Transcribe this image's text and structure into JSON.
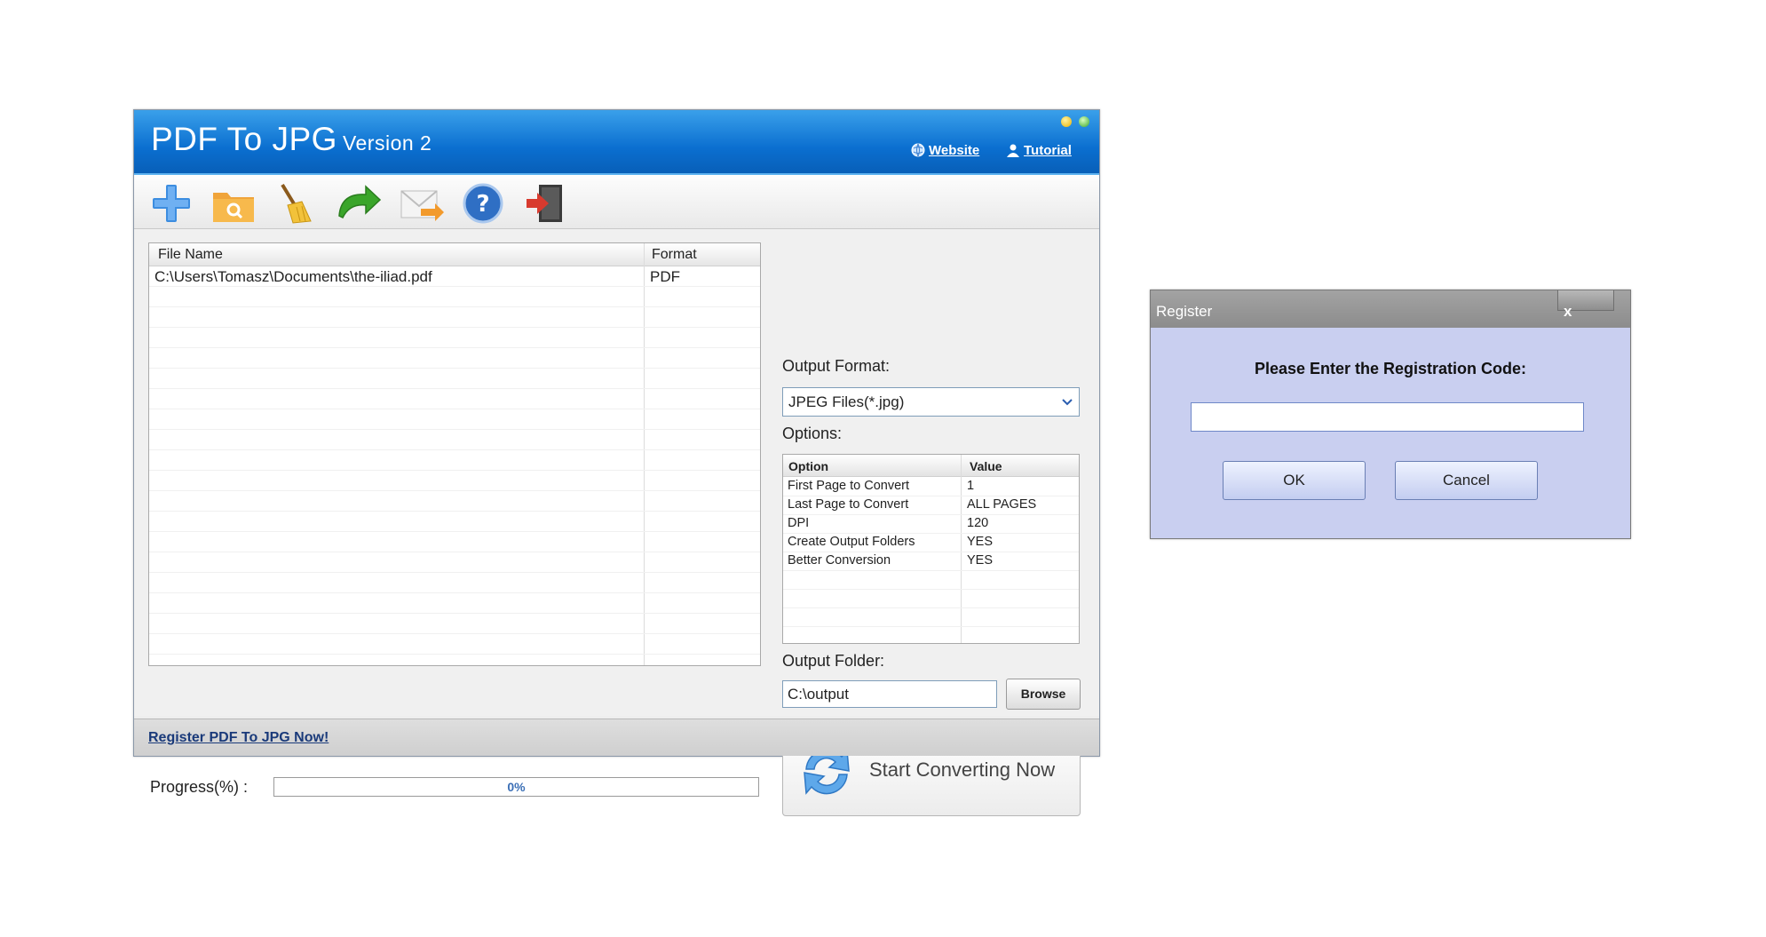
{
  "app": {
    "title": "PDF To JPG",
    "version": "Version 2",
    "links": {
      "website": "Website",
      "tutorial": "Tutorial"
    },
    "toolbar_icons": [
      "add-icon",
      "open-folder-icon",
      "clear-broom-icon",
      "convert-arrow-icon",
      "email-icon",
      "help-icon",
      "exit-icon"
    ]
  },
  "file_list": {
    "headers": {
      "file_name": "File Name",
      "format": "Format"
    },
    "rows": [
      {
        "file_name": "C:\\Users\\Tomasz\\Documents\\the-iliad.pdf",
        "format": "PDF"
      }
    ]
  },
  "output_format": {
    "label": "Output Format:",
    "selected": "JPEG Files(*.jpg)"
  },
  "options": {
    "label": "Options:",
    "headers": {
      "option": "Option",
      "value": "Value"
    },
    "rows": [
      {
        "option": "First Page to Convert",
        "value": "1"
      },
      {
        "option": "Last Page to Convert",
        "value": "ALL PAGES"
      },
      {
        "option": "DPI",
        "value": "120"
      },
      {
        "option": "Create Output Folders",
        "value": "YES"
      },
      {
        "option": "Better Conversion",
        "value": "YES"
      }
    ]
  },
  "output_folder": {
    "label": "Output Folder:",
    "value": "C:\\output",
    "browse_label": "Browse"
  },
  "start_button": {
    "label": "Start Converting Now"
  },
  "progress": {
    "label": "Progress(%)  :",
    "value": 0,
    "text": "0%"
  },
  "status_bar": {
    "register_link": "Register PDF To JPG Now!"
  },
  "register_dialog": {
    "title": "Register",
    "close_label": "x",
    "prompt": "Please Enter the Registration Code:",
    "code_value": "",
    "ok_label": "OK",
    "cancel_label": "Cancel"
  },
  "colors": {
    "title_bar": "#0b6fd0",
    "dialog_bg": "#c9cff0",
    "dialog_title": "#8c8c8c"
  }
}
